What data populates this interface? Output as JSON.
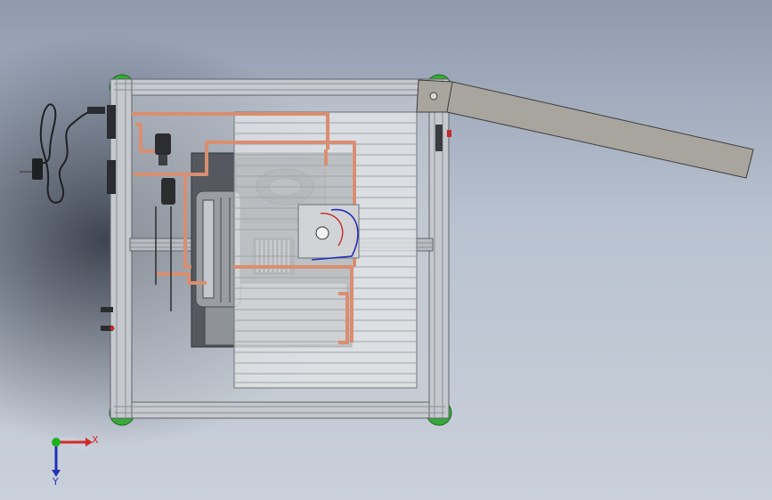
{
  "triad": {
    "x_label": "X",
    "y_label": "Y",
    "x_color": "#d42a2a",
    "y_color": "#2431b4",
    "origin_color": "#1db31d"
  },
  "colors": {
    "frame": "#bfc3c9",
    "frame_dark": "#6d7278",
    "pipe": "#d98e71",
    "foot": "#3aa83a",
    "lid": "#a8a59f",
    "panel": "#e6e7e9",
    "machine": "#5b5e63"
  },
  "icons": [
    "power-plug-icon",
    "cable-icon",
    "foot-icon",
    "valve-icon",
    "wire-icon"
  ]
}
